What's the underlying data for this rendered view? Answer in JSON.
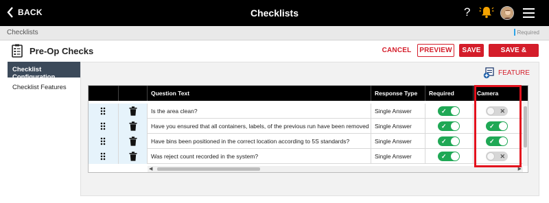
{
  "topbar": {
    "back_label": "BACK",
    "title": "Checklists",
    "help_label": "?"
  },
  "breadcrumb": {
    "current": "Checklists",
    "required_legend": "Required"
  },
  "page": {
    "title": "Pre-Op Checks"
  },
  "actions": {
    "cancel": "CANCEL",
    "preview": "PREVIEW",
    "save": "SAVE",
    "save_close": "SAVE & CLOSE"
  },
  "nav": {
    "items": [
      {
        "label": "Checklist Configuration",
        "active": true
      },
      {
        "label": "Checklist Features",
        "active": false
      }
    ]
  },
  "feature_button": {
    "label": "FEATURE"
  },
  "grid": {
    "columns": [
      "Question Text",
      "Response Type",
      "Required",
      "Camera"
    ],
    "rows": [
      {
        "question": "Is the area clean?",
        "response_type": "Single Answer",
        "required": true,
        "camera": false
      },
      {
        "question": "Have you ensured that all containers, labels, of the previous run have been removed from...",
        "response_type": "Single Answer",
        "required": true,
        "camera": true
      },
      {
        "question": "Have bins been positioned in the correct location according to 5S standards?",
        "response_type": "Single Answer",
        "required": true,
        "camera": true
      },
      {
        "question": "Was reject count recorded in the system?",
        "response_type": "Single Answer",
        "required": true,
        "camera": false
      }
    ]
  },
  "colors": {
    "accent_red": "#d41d2a",
    "toggle_on": "#1fa855",
    "header_black": "#000000",
    "nav_active": "#3c4a5a",
    "highlight_box": "#e3111d"
  }
}
